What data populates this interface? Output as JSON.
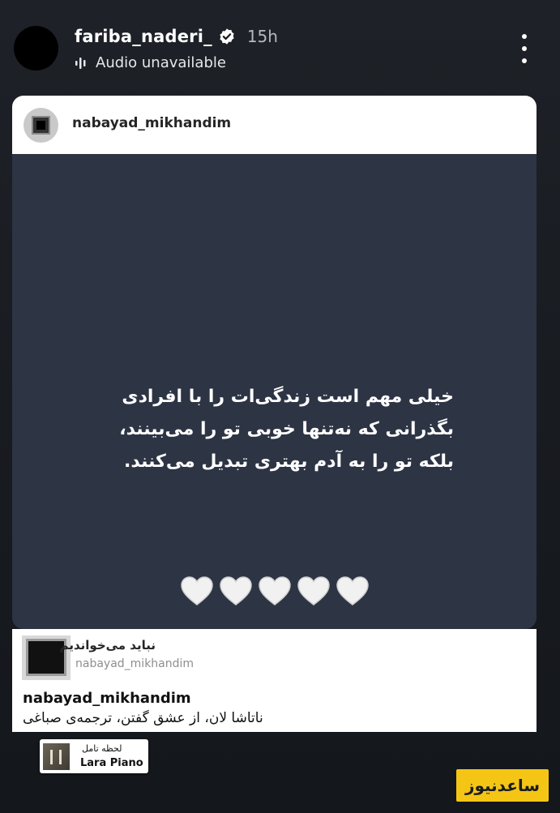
{
  "header": {
    "username": "fariba_naderi_",
    "time": "15h",
    "audio_label": "Audio unavailable"
  },
  "card": {
    "username": "nabayad_mikhandim",
    "quote_lines": [
      "خیلی مهم است زندگی‌ات را با افرادی",
      "بگذرانی که نه‌تنها خوبی تو را می‌بینند،",
      "بلکه تو را به آدم بهتری تبدیل می‌کنند."
    ],
    "hearts": "🤍🤍🤍🤍🤍"
  },
  "music": {
    "title": "نباید می‌خواندیم",
    "handle": "nabayad_mikhandim",
    "caption_user": "nabayad_mikhandim",
    "caption_text": "ناتاشا لان، از عشق گفتن، ترجمه‌ی صباغی"
  },
  "sticker": {
    "title": "لحظه تامل",
    "artist": "Lara Piano"
  },
  "watermark": {
    "text": "ساعدنیوز"
  },
  "colors": {
    "background": "#15181d",
    "card_body": "#2d3444",
    "watermark": "#f4c515",
    "verified": "#ffffff"
  },
  "icons": {
    "verified": "verified-badge-icon",
    "audio": "audio-off-icon",
    "more": "more-vertical-icon",
    "heart": "white-heart-icon"
  }
}
